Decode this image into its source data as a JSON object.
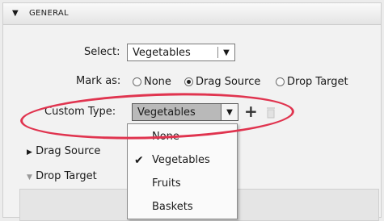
{
  "section": {
    "toggle_icon": "triangle-down-icon",
    "title": "GENERAL"
  },
  "select_row": {
    "label": "Select:",
    "value": "Vegetables"
  },
  "mark_as": {
    "label": "Mark as:",
    "options": [
      "None",
      "Drag Source",
      "Drop Target"
    ],
    "selected": "Drag Source"
  },
  "custom_type": {
    "label": "Custom Type:",
    "value": "Vegetables",
    "add_icon": "plus-icon",
    "delete_icon": "trash-icon"
  },
  "dropdown": {
    "items": [
      "None",
      "Vegetables",
      "Fruits",
      "Baskets"
    ],
    "checked": "Vegetables"
  },
  "drag_source": {
    "label": "Drag Source",
    "expanded": false
  },
  "drop_target": {
    "label": "Drop Target",
    "expanded": true
  },
  "colors": {
    "highlight": "#e0344f",
    "field_selected": "#b9b9b9"
  }
}
